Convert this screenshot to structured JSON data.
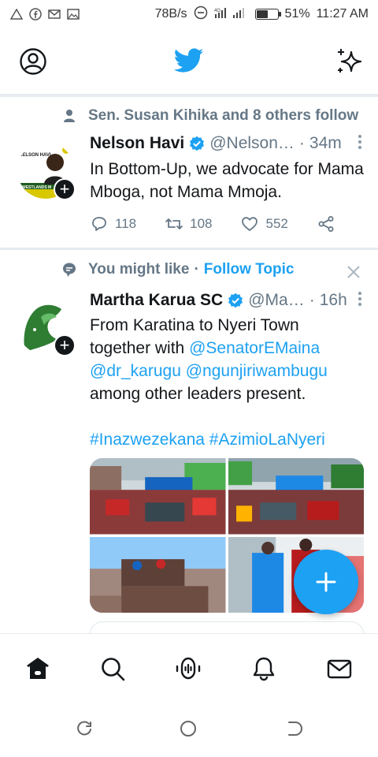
{
  "status_bar": {
    "speed": "78B/s",
    "battery": "51%",
    "battery_level": 0.51,
    "time": "11:27 AM",
    "left_icons": [
      "warning-icon",
      "facebook-icon",
      "gmail-icon",
      "gallery-icon"
    ]
  },
  "app_bar": {
    "left_icon": "profile-icon",
    "center_icon": "twitter-bird-icon",
    "right_icon": "sparkle-icon"
  },
  "tweets": [
    {
      "context": "Sen. Susan Kihika and 8 others follow",
      "avatar_text": "NELSON HAVI",
      "avatar_banner": "WESTLANDS M",
      "name": "Nelson Havi",
      "handle": "@Nelson…",
      "separator": "·",
      "time": "34m",
      "body": "In Bottom-Up, we advocate for Mama Mboga, not Mama Mmoja.",
      "replies": "118",
      "retweets": "108",
      "likes": "552"
    },
    {
      "context": "You might like",
      "context_sep": "·",
      "follow_topic": "Follow Topic",
      "name": "Martha Karua SC",
      "handle": "@Ma…",
      "separator": "·",
      "time": "16h",
      "body_line1": "From Karatina to Nyeri Town",
      "body_line2": "together with",
      "mention1": "@SenatorEMaina",
      "mention2": "@dr_karugu",
      "mention3": "@ngunjiriwambugu",
      "body_line4": "among other leaders present.",
      "hashtag1": "#Inazwezekana",
      "hashtag2": "#AzimioLaNyeri"
    }
  ],
  "fab": {
    "label": "+"
  },
  "bottom_nav": [
    "home-icon",
    "search-icon",
    "spaces-icon",
    "notifications-icon",
    "messages-icon"
  ],
  "system_nav": [
    "recents-icon",
    "home-circle-icon",
    "back-icon"
  ],
  "colors": {
    "accent": "#1da1f2",
    "text": "#14171a",
    "secondary": "#657786",
    "divider": "#e6ecf0"
  }
}
